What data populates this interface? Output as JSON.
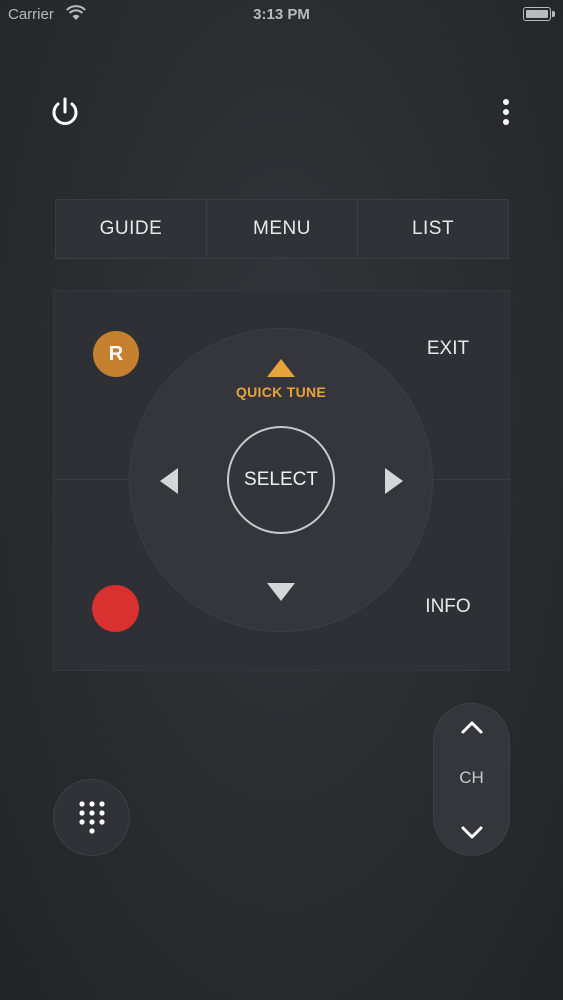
{
  "status_bar": {
    "carrier": "Carrier",
    "time": "3:13 PM",
    "battery_percent": 100
  },
  "top_buttons": [
    {
      "label": "GUIDE"
    },
    {
      "label": "MENU"
    },
    {
      "label": "LIST"
    }
  ],
  "dpad": {
    "select_label": "SELECT",
    "quick_tune_label": "QUICK TUNE",
    "up_arrow_color": "#e8a33a"
  },
  "side_buttons": {
    "r_label": "R",
    "r_color": "#c5812f",
    "record_color": "#d8312f",
    "exit_label": "EXIT",
    "info_label": "INFO"
  },
  "channel": {
    "label": "CH"
  },
  "icons": [
    "power-icon",
    "more-vertical-icon",
    "keypad-icon",
    "chevron-up-icon",
    "chevron-down-icon",
    "wifi-icon",
    "battery-icon"
  ]
}
